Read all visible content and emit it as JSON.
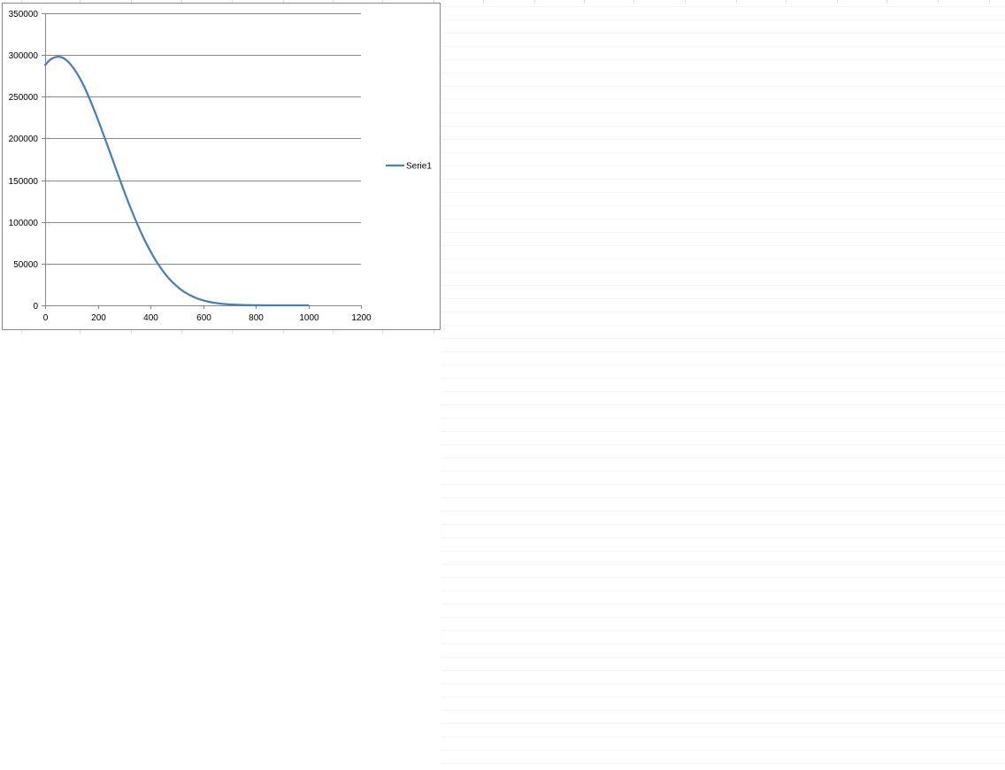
{
  "chart_data": {
    "type": "line",
    "title": "",
    "xlabel": "",
    "ylabel": "",
    "xlim": [
      0,
      1200
    ],
    "ylim": [
      0,
      350000
    ],
    "x_ticks": [
      0,
      200,
      400,
      600,
      800,
      1000,
      1200
    ],
    "y_ticks": [
      0,
      50000,
      100000,
      150000,
      200000,
      250000,
      300000,
      350000
    ],
    "x_tick_labels": [
      "0",
      "200",
      "400",
      "600",
      "800",
      "1000",
      "1200"
    ],
    "y_tick_labels": [
      "0",
      "50000",
      "100000",
      "150000",
      "200000",
      "250000",
      "300000",
      "350000"
    ],
    "grid": "horizontal",
    "legend_position": "right",
    "series": [
      {
        "name": "Serie1",
        "color": "#4a7ebb",
        "x": [
          0,
          20,
          40,
          60,
          80,
          100,
          120,
          140,
          160,
          180,
          200,
          220,
          240,
          260,
          280,
          300,
          320,
          340,
          360,
          380,
          400,
          420,
          440,
          460,
          480,
          500,
          520,
          540,
          560,
          580,
          600,
          620,
          640,
          660,
          680,
          700,
          720,
          740,
          760,
          780,
          800,
          820,
          840,
          860,
          880,
          900,
          920,
          940,
          960,
          980,
          1000
        ],
        "y": [
          288000,
          294500,
          297500,
          297500,
          294000,
          287500,
          278500,
          267500,
          254000,
          239000,
          223000,
          206000,
          189000,
          171500,
          154000,
          137000,
          120500,
          105000,
          90500,
          77000,
          65000,
          54000,
          44500,
          36000,
          29000,
          23000,
          18000,
          14000,
          10700,
          8000,
          6000,
          4400,
          3200,
          2300,
          1600,
          1100,
          750,
          500,
          330,
          210,
          130,
          80,
          50,
          30,
          18,
          10,
          6,
          3,
          2,
          1,
          0
        ]
      }
    ]
  }
}
